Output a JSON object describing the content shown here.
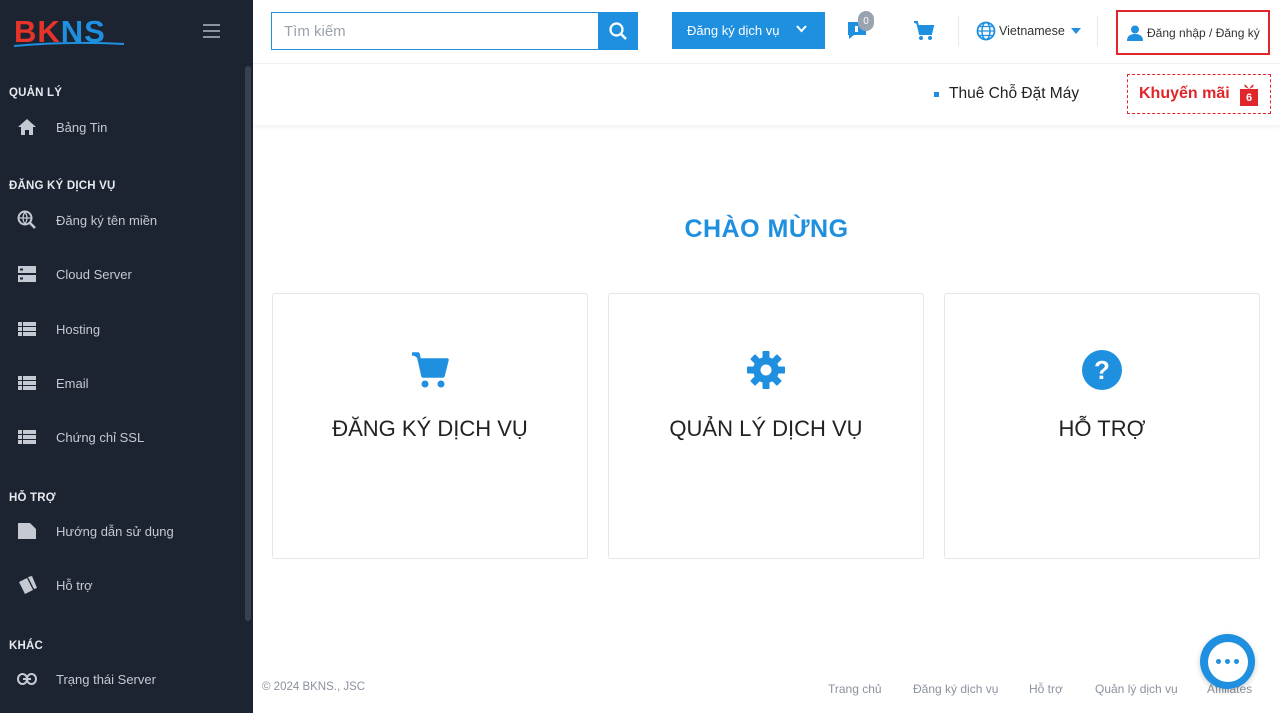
{
  "brand": {
    "logo_text": [
      "B",
      "K",
      "N",
      "S"
    ],
    "colors": {
      "red": "#e8332a",
      "blue": "#1f8fe0"
    }
  },
  "header": {
    "search_placeholder": "Tìm kiếm",
    "register_label": "Đăng ký dịch vụ",
    "message_count": "0",
    "language": "Vietnamese",
    "login_label": "Đăng nhập / Đăng ký"
  },
  "subbar": {
    "link_label": "Thuê Chỗ Đặt Máy",
    "promo_label": "Khuyến mãi",
    "promo_count": "6"
  },
  "sidebar": {
    "sections": [
      {
        "title": "QUẢN LÝ",
        "items": [
          {
            "label": "Bảng Tin",
            "icon": "home-icon"
          }
        ]
      },
      {
        "title": "ĐĂNG KÝ DỊCH VỤ",
        "items": [
          {
            "label": "Đăng ký tên miền",
            "icon": "domain-search-icon"
          },
          {
            "label": "Cloud Server",
            "icon": "server-icon"
          },
          {
            "label": "Hosting",
            "icon": "list-icon"
          },
          {
            "label": "Email",
            "icon": "list-icon"
          },
          {
            "label": "Chứng chỉ SSL",
            "icon": "list-icon"
          }
        ]
      },
      {
        "title": "HỖ TRỢ",
        "items": [
          {
            "label": "Hướng dẫn sử dụng",
            "icon": "tag-icon"
          },
          {
            "label": "Hỗ trợ",
            "icon": "ticket-icon"
          }
        ]
      },
      {
        "title": "KHÁC",
        "items": [
          {
            "label": "Trạng thái Server",
            "icon": "link-icon"
          }
        ]
      }
    ]
  },
  "main": {
    "welcome": "CHÀO MỪNG",
    "cards": [
      {
        "label": "ĐĂNG KÝ DỊCH VỤ",
        "icon": "cart-icon"
      },
      {
        "label": "QUẢN LÝ DỊCH VỤ",
        "icon": "gear-icon"
      },
      {
        "label": "HỖ TRỢ",
        "icon": "question-icon"
      }
    ]
  },
  "footer": {
    "copyright": "© 2024 BKNS., JSC",
    "links": [
      "Trang chủ",
      "Đăng ký dịch vụ",
      "Hỗ trợ",
      "Quản lý dịch vụ",
      "Affiliates"
    ]
  }
}
